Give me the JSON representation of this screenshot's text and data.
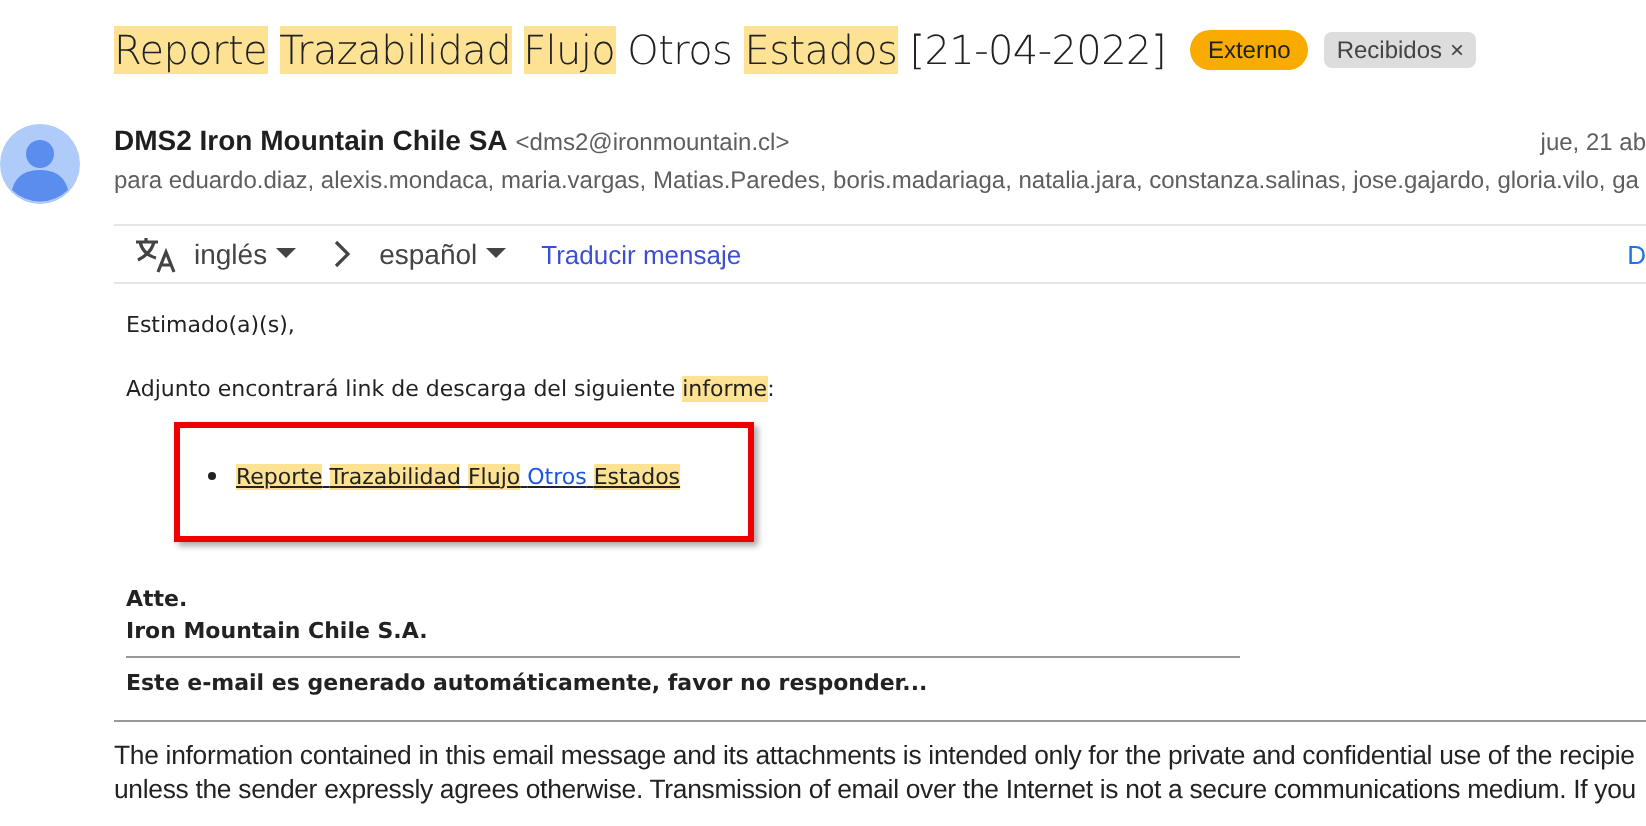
{
  "subject": {
    "words": [
      {
        "text": "Reporte",
        "highlighted": true
      },
      {
        "text": "Trazabilidad",
        "highlighted": true
      },
      {
        "text": "Flujo",
        "highlighted": true
      },
      {
        "text": "Otros",
        "highlighted": false
      },
      {
        "text": "Estados",
        "highlighted": true
      },
      {
        "text": "[21-04-2022]",
        "highlighted": false
      }
    ]
  },
  "labels": [
    {
      "text": "Externo",
      "kind": "external"
    },
    {
      "text": "Recibidos",
      "kind": "folder",
      "close": "×"
    }
  ],
  "sender": {
    "name": "DMS2 Iron Mountain Chile SA",
    "email": "<dms2@ironmountain.cl>",
    "date": "jue, 21 ab",
    "recipients": "para eduardo.diaz, alexis.mondaca, maria.vargas, Matias.Paredes, boris.madariaga, natalia.jara, constanza.salinas, jose.gajardo, gloria.vilo, ga"
  },
  "translate_bar": {
    "from": "inglés",
    "to": "español",
    "action": "Traducir mensaje",
    "right": "D"
  },
  "body": {
    "greeting": "Estimado(a)(s),",
    "intro": [
      {
        "text": "Adjunto encontrará link de descarga del siguiente ",
        "highlighted": false
      },
      {
        "text": "informe",
        "highlighted": true
      },
      {
        "text": ":",
        "highlighted": false
      }
    ],
    "link_words": [
      {
        "text": "Reporte",
        "highlighted": true
      },
      {
        "text": "Trazabilidad",
        "highlighted": true
      },
      {
        "text": "Flujo",
        "highlighted": true
      },
      {
        "text": "Otros",
        "highlighted": false
      },
      {
        "text": "Estados",
        "highlighted": true
      }
    ],
    "signoff": "Atte.",
    "company": "Iron Mountain Chile S.A.",
    "notice": "Este e-mail es generado automáticamente, favor no responder..."
  },
  "disclaimer": [
    "The information contained in this email message and its attachments is intended only for the private and confidential use of the recipie",
    "unless the sender expressly agrees otherwise. Transmission of email over the Internet is not a secure communications medium. If you"
  ]
}
